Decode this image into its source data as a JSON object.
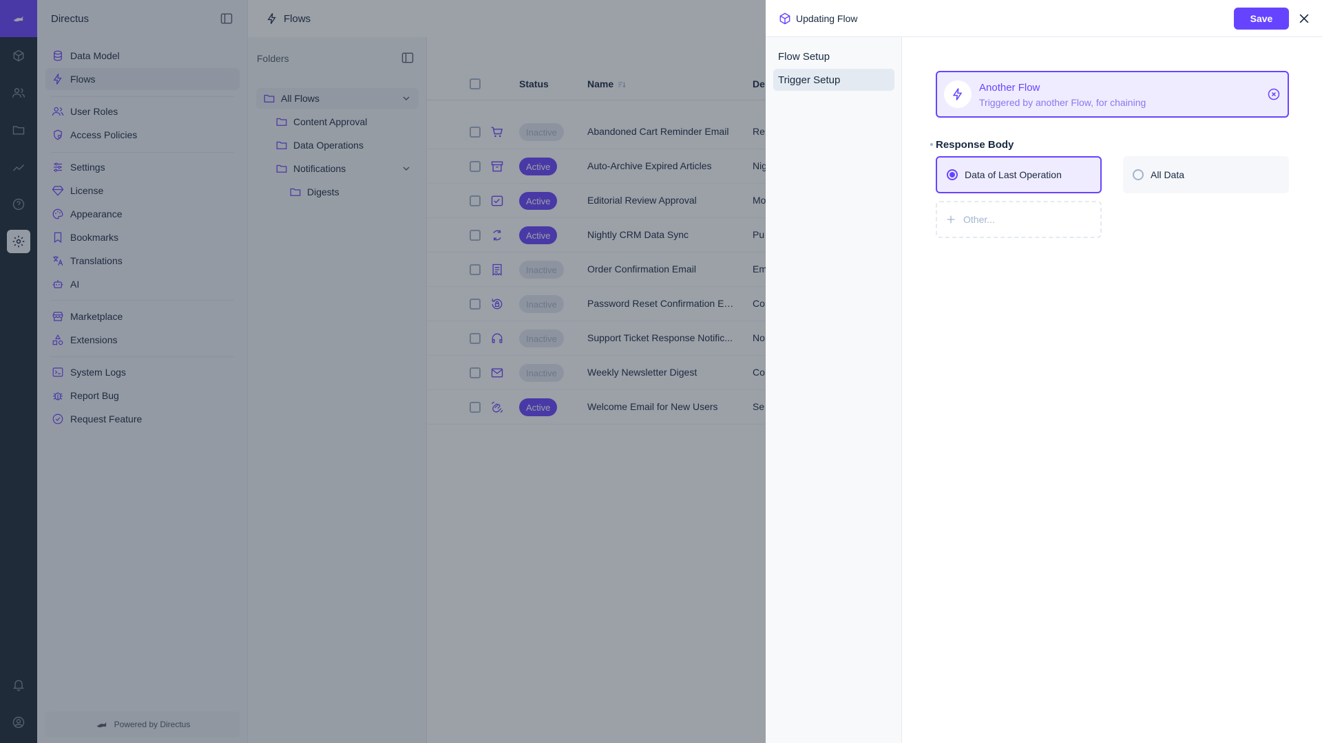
{
  "app": {
    "name": "Directus",
    "powered_by": "Powered by Directus"
  },
  "nav": {
    "items": [
      {
        "label": "Data Model",
        "icon": "database-icon"
      },
      {
        "label": "Flows",
        "icon": "bolt-icon"
      },
      {
        "label": "User Roles",
        "icon": "users-icon"
      },
      {
        "label": "Access Policies",
        "icon": "policy-icon"
      },
      {
        "label": "Settings",
        "icon": "sliders-icon"
      },
      {
        "label": "License",
        "icon": "diamond-icon"
      },
      {
        "label": "Appearance",
        "icon": "palette-icon"
      },
      {
        "label": "Bookmarks",
        "icon": "bookmark-icon"
      },
      {
        "label": "Translations",
        "icon": "translate-icon"
      },
      {
        "label": "AI",
        "icon": "robot-icon"
      },
      {
        "label": "Marketplace",
        "icon": "store-icon"
      },
      {
        "label": "Extensions",
        "icon": "extensions-icon"
      },
      {
        "label": "System Logs",
        "icon": "terminal-icon"
      },
      {
        "label": "Report Bug",
        "icon": "bug-icon"
      },
      {
        "label": "Request Feature",
        "icon": "check-badge-icon"
      }
    ]
  },
  "header": {
    "title": "Flows"
  },
  "folders": {
    "title": "Folders",
    "items": [
      {
        "label": "All Flows"
      },
      {
        "label": "Content Approval"
      },
      {
        "label": "Data Operations"
      },
      {
        "label": "Notifications"
      },
      {
        "label": "Digests"
      }
    ]
  },
  "table": {
    "headers": {
      "status": "Status",
      "name": "Name",
      "description": "De"
    },
    "rows": [
      {
        "status": "Inactive",
        "name": "Abandoned Cart Reminder Email",
        "desc": "Re",
        "icon": "cart-icon"
      },
      {
        "status": "Active",
        "name": "Auto-Archive Expired Articles",
        "desc": "Nig",
        "icon": "archive-icon"
      },
      {
        "status": "Active",
        "name": "Editorial Review Approval",
        "desc": "Mo",
        "icon": "approval-icon"
      },
      {
        "status": "Active",
        "name": "Nightly CRM Data Sync",
        "desc": "Pu",
        "icon": "sync-icon"
      },
      {
        "status": "Inactive",
        "name": "Order Confirmation Email",
        "desc": "Em",
        "icon": "receipt-icon"
      },
      {
        "status": "Inactive",
        "name": "Password Reset Confirmation Em...",
        "desc": "Co",
        "icon": "lock-reset-icon"
      },
      {
        "status": "Inactive",
        "name": "Support Ticket Response Notific...",
        "desc": "No",
        "icon": "headset-icon"
      },
      {
        "status": "Inactive",
        "name": "Weekly Newsletter Digest",
        "desc": "Co",
        "icon": "mail-icon"
      },
      {
        "status": "Active",
        "name": "Welcome Email for New Users",
        "desc": "Se",
        "icon": "wave-icon"
      }
    ]
  },
  "drawer": {
    "title": "Updating Flow",
    "save_label": "Save",
    "tabs": [
      {
        "label": "Flow Setup"
      },
      {
        "label": "Trigger Setup"
      }
    ],
    "trigger": {
      "name": "Another Flow",
      "description": "Triggered by another Flow, for chaining"
    },
    "response_body": {
      "label": "Response Body",
      "options": [
        {
          "label": "Data of Last Operation",
          "selected": true
        },
        {
          "label": "All Data",
          "selected": false
        }
      ],
      "other_placeholder": "Other..."
    }
  },
  "colors": {
    "accent": "#6644ff",
    "nav_bg": "#f0f4f9",
    "module_bar": "#1d2b35"
  }
}
